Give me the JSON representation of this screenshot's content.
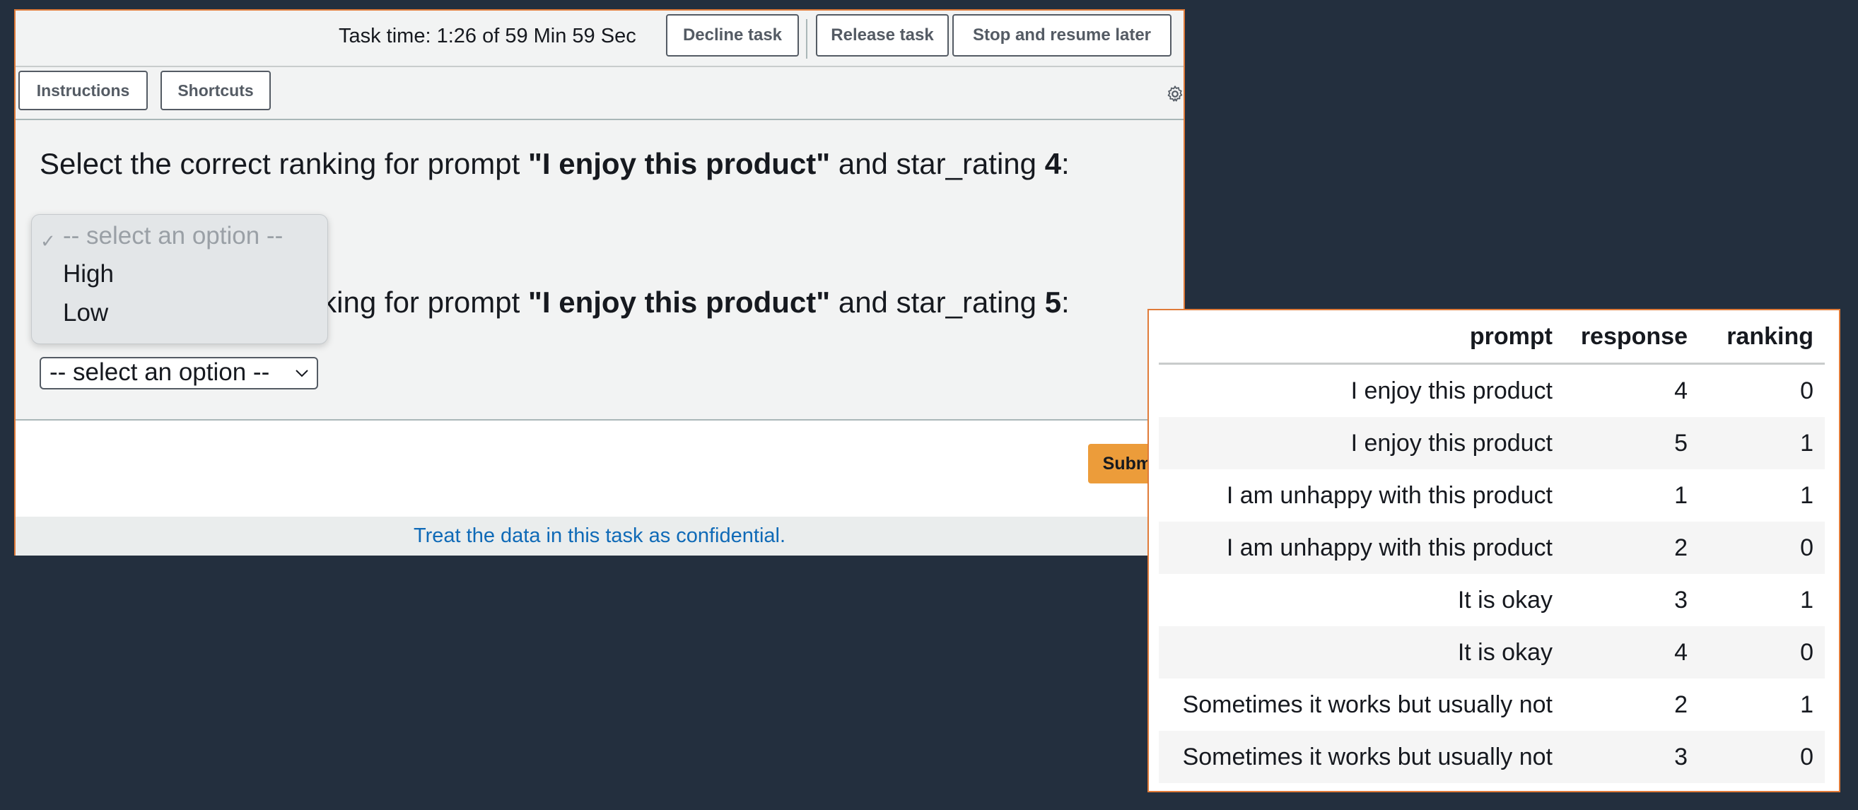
{
  "task_panel": {
    "task_time": "Task time: 1:26 of 59 Min 59 Sec",
    "buttons": {
      "decline": "Decline task",
      "release": "Release task",
      "stop_resume": "Stop and resume later"
    },
    "toolbar": {
      "instructions": "Instructions",
      "shortcuts": "Shortcuts",
      "settings_icon": "gear-icon"
    },
    "questions": [
      {
        "pre": "Select the correct ranking for prompt ",
        "prompt": "\"I enjoy this product\"",
        "mid": " and star_rating ",
        "rating": "4",
        "post": ":"
      },
      {
        "pre": "Select the correct ranking for prompt ",
        "prompt": "\"I enjoy this product\"",
        "mid": " and star_rating ",
        "rating": "5",
        "post": ":"
      }
    ],
    "dropdown": {
      "check": "✓",
      "options": [
        "-- select an option --",
        "High",
        "Low"
      ]
    },
    "select_value": "-- select an option --",
    "submit": "Submit",
    "confidential": "Treat the data in this task as confidential."
  },
  "data_table": {
    "columns": [
      "prompt",
      "response",
      "ranking"
    ],
    "rows": [
      [
        "I enjoy this product",
        "4",
        "0"
      ],
      [
        "I enjoy this product",
        "5",
        "1"
      ],
      [
        "I am unhappy with this product",
        "1",
        "1"
      ],
      [
        "I am unhappy with this product",
        "2",
        "0"
      ],
      [
        "It is okay",
        "3",
        "1"
      ],
      [
        "It is okay",
        "4",
        "0"
      ],
      [
        "Sometimes it works but usually not",
        "2",
        "1"
      ],
      [
        "Sometimes it works but usually not",
        "3",
        "0"
      ]
    ]
  },
  "colors": {
    "background": "#232f3e",
    "panel_border": "#e07b39",
    "submit": "#ec9c3a",
    "link": "#0f6ab7"
  }
}
